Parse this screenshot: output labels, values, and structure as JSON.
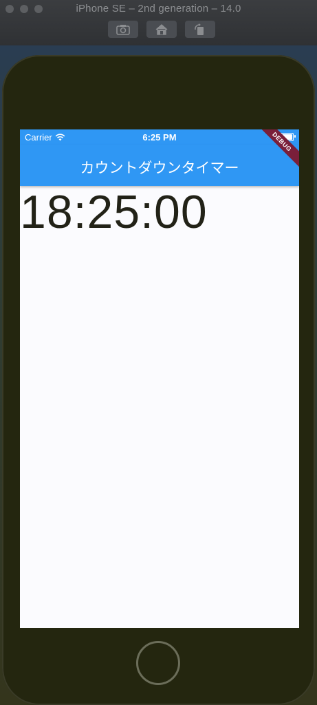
{
  "simulator": {
    "window_title": "iPhone SE – 2nd generation – 14.0",
    "toolbar": {
      "screenshot_icon": "camera-icon",
      "home_icon": "home-icon",
      "rotate_icon": "rotate-icon"
    }
  },
  "status_bar": {
    "carrier": "Carrier",
    "time": "6:25 PM",
    "wifi_icon": "wifi-icon",
    "battery_icon": "battery-icon"
  },
  "app_bar": {
    "title": "カウントダウンタイマー",
    "color": "#2f97f4"
  },
  "debug_banner": "DEBUG",
  "body": {
    "timer_text": "18:25:00"
  }
}
